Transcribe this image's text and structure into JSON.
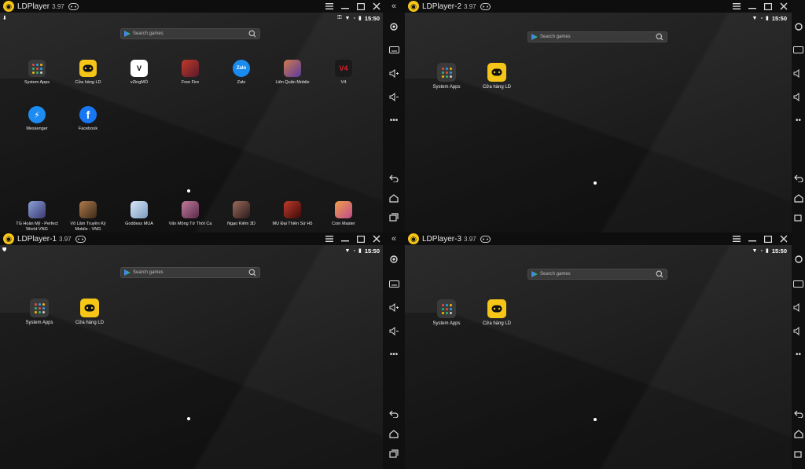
{
  "common": {
    "search_placeholder": "Search games",
    "time": "15:50",
    "version": "3.97",
    "apps_default": [
      {
        "label": "System Apps",
        "icon": "system-apps-icon"
      },
      {
        "label": "Cửa hàng LD",
        "icon": "ld-store-icon"
      }
    ]
  },
  "windows": [
    {
      "title": "LDPlayer",
      "apps_row1": [
        {
          "label": "System Apps",
          "icon": "system-apps-icon",
          "glyph": "",
          "bg": "#3a3a3a"
        },
        {
          "label": "Cửa hàng LD",
          "icon": "ld-store-icon",
          "glyph": "",
          "bg": "#f5c518"
        },
        {
          "label": "vZingMÒ",
          "icon": "vzing-icon",
          "glyph": "V",
          "bg": "#ffffff",
          "fg": "#000"
        },
        {
          "label": "Free Fire",
          "icon": "free-fire-icon",
          "glyph": "",
          "bg": "#9b2a2a"
        },
        {
          "label": "Zalo",
          "icon": "zalo-icon",
          "glyph": "Zalo",
          "bg": "#1a8cf0"
        },
        {
          "label": "Liên Quân Mobile",
          "icon": "lien-quan-icon",
          "glyph": "",
          "bg": "#7a5bb0"
        },
        {
          "label": "V4",
          "icon": "v4-icon",
          "glyph": "V4",
          "bg": "#1a1a1a",
          "fg": "#e0202a"
        }
      ],
      "apps_row2": [
        {
          "label": "Messenger",
          "icon": "messenger-icon",
          "glyph": "✉",
          "bg": "#1c8cf2"
        },
        {
          "label": "Facebook",
          "icon": "facebook-icon",
          "glyph": "f",
          "bg": "#1877f2"
        }
      ],
      "apps_dock": [
        {
          "label": "TG Hoàn Mỹ - Perfect World VNG",
          "icon": "perfect-world-icon",
          "bg": "#5c6aa8"
        },
        {
          "label": "Võ Lâm Truyền Kỳ Mobile - VNG",
          "icon": "vo-lam-icon",
          "bg": "#7a4c2a"
        },
        {
          "label": "Goddess MUA",
          "icon": "goddess-mua-icon",
          "bg": "#a9c6e0"
        },
        {
          "label": "Vấn Mộng Tứ Thời Ca",
          "icon": "van-mong-icon",
          "bg": "#8a4a6a"
        },
        {
          "label": "Ngạo Kiếm 3D",
          "icon": "ngao-kiem-icon",
          "bg": "#5a3a3a"
        },
        {
          "label": "MU Đại Thiên Sứ H5",
          "icon": "mu-icon",
          "bg": "#6a1a1a"
        },
        {
          "label": "Coin Master",
          "icon": "coin-master-icon",
          "bg": "#e07a2a"
        }
      ]
    },
    {
      "title": "LDPlayer-2"
    },
    {
      "title": "LDPlayer-1"
    },
    {
      "title": "LDPlayer-3"
    }
  ]
}
